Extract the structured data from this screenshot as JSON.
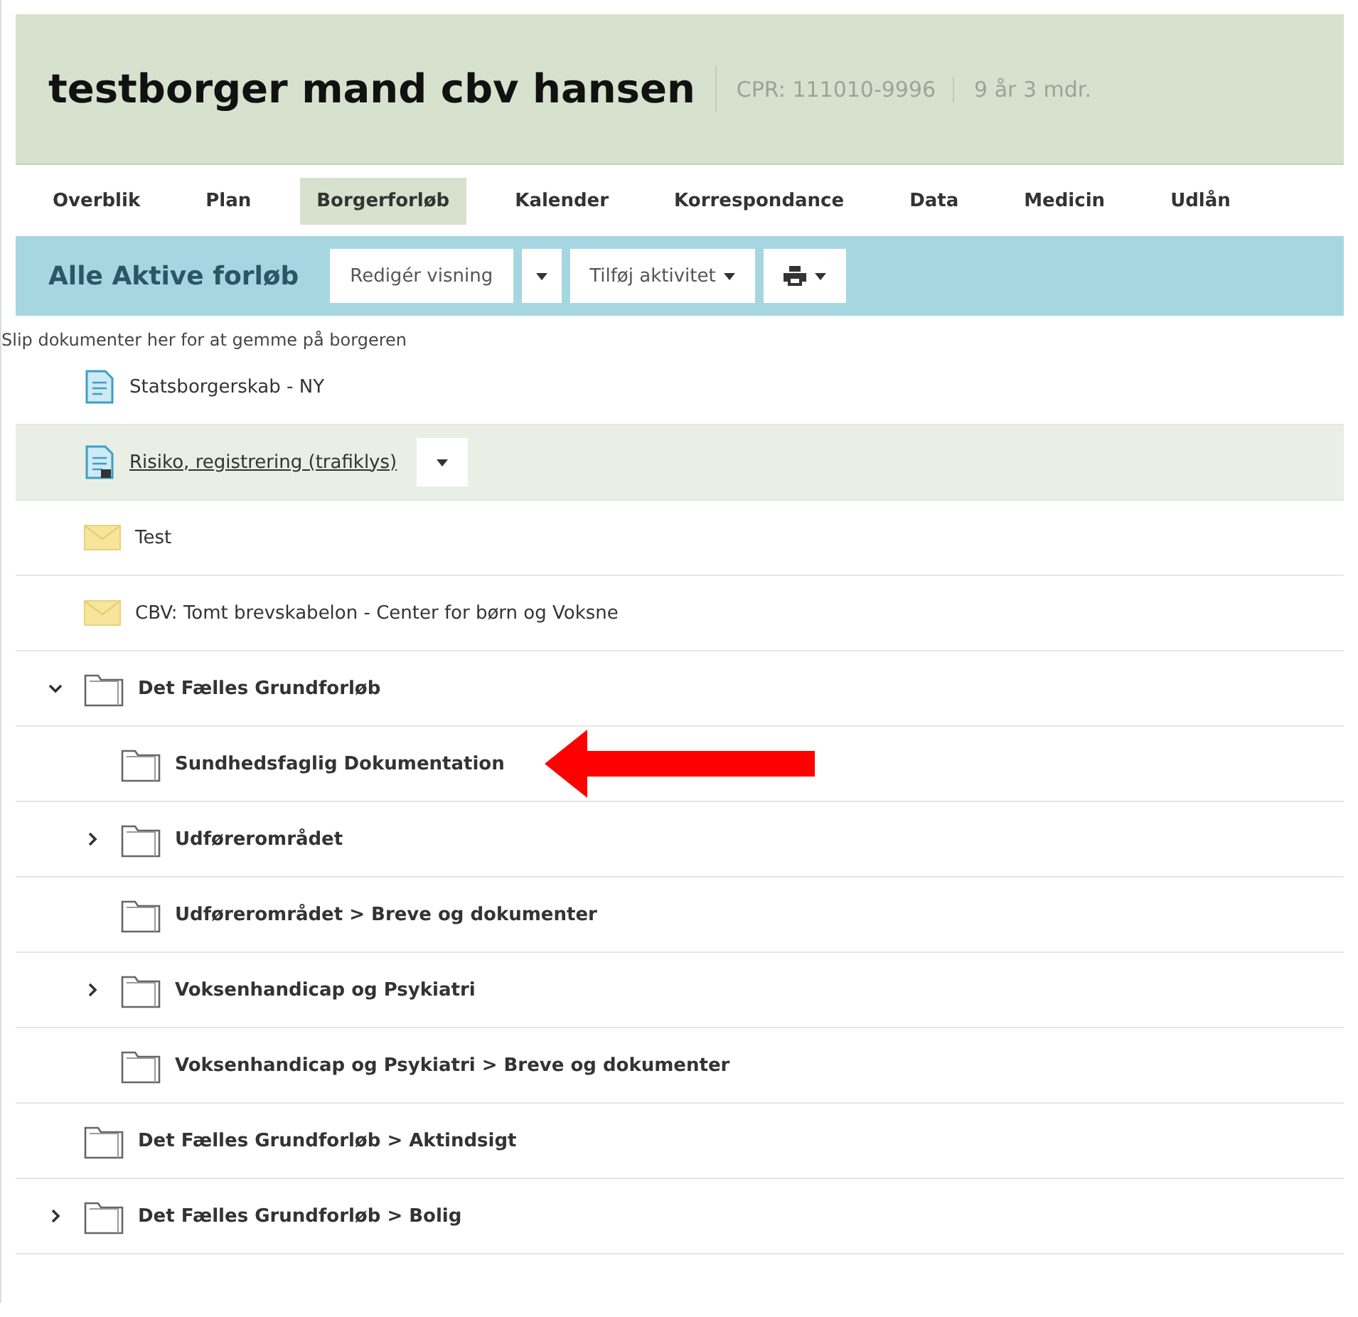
{
  "header": {
    "name": "testborger mand cbv hansen",
    "cpr": "CPR: 111010-9996",
    "age": "9 år 3 mdr."
  },
  "tabs": [
    {
      "label": "Overblik",
      "selected": false
    },
    {
      "label": "Plan",
      "selected": false
    },
    {
      "label": "Borgerforløb",
      "selected": true
    },
    {
      "label": "Kalender",
      "selected": false
    },
    {
      "label": "Korrespondance",
      "selected": false
    },
    {
      "label": "Data",
      "selected": false
    },
    {
      "label": "Medicin",
      "selected": false
    },
    {
      "label": "Udlån",
      "selected": false
    }
  ],
  "toolbar": {
    "title": "Alle Aktive forløb",
    "edit_view": "Redigér visning",
    "add_activity": "Tilføj aktivitet"
  },
  "drop_hint": "Slip dokumenter her for at gemme på borgeren",
  "items": [
    {
      "kind": "form",
      "label": "Statsborgerskab - NY",
      "selected": false,
      "marked": false
    },
    {
      "kind": "form-locked",
      "label": "Risiko, registrering (trafiklys)",
      "selected": true,
      "marked": false
    },
    {
      "kind": "letter",
      "label": "Test",
      "selected": false,
      "marked": false
    },
    {
      "kind": "letter",
      "label": "CBV: Tomt brevskabelon - Center for børn og Voksne",
      "selected": false,
      "marked": false
    },
    {
      "kind": "folder",
      "label": "Det Fælles Grundforløb",
      "selected": false,
      "marked": false,
      "expanded": true,
      "children": [
        {
          "kind": "folder",
          "label": "Sundhedsfaglig Dokumentation",
          "selected": false,
          "marked": true
        },
        {
          "kind": "folder",
          "label": "Udførerområdet",
          "selected": false,
          "marked": false,
          "expanded": false
        },
        {
          "kind": "folder",
          "label": "Udførerområdet > Breve og dokumenter",
          "selected": false,
          "marked": false
        },
        {
          "kind": "folder",
          "label": "Voksenhandicap og Psykiatri",
          "selected": false,
          "marked": false,
          "expanded": false
        },
        {
          "kind": "folder",
          "label": "Voksenhandicap og Psykiatri > Breve og dokumenter",
          "selected": false,
          "marked": false
        }
      ]
    },
    {
      "kind": "folder",
      "label": "Det Fælles Grundforløb > Aktindsigt",
      "selected": false,
      "marked": false
    },
    {
      "kind": "folder",
      "label": "Det Fælles Grundforløb > Bolig",
      "selected": false,
      "marked": false,
      "expanded": false
    }
  ]
}
